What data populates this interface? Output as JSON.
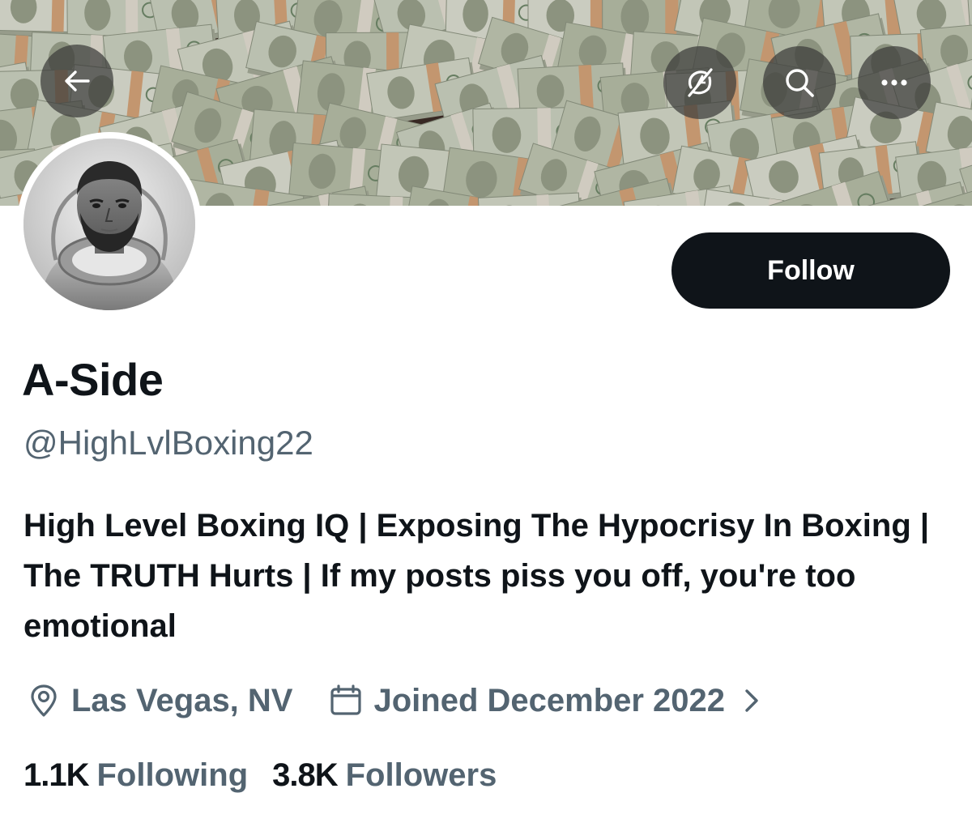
{
  "banner": {
    "description_icon": "money-stacks-banner"
  },
  "toolbar": {
    "back_icon": "arrow-left-icon",
    "notifications_icon": "bell-off-icon",
    "search_icon": "search-icon",
    "more_icon": "more-horizontal-icon"
  },
  "profile": {
    "display_name": "A-Side",
    "handle": "@HighLvlBoxing22",
    "bio": "High Level Boxing IQ | Exposing The Hypocrisy In Boxing | The TRUTH Hurts | If my posts piss you off, you're too emotional",
    "location": "Las Vegas, NV",
    "joined": "Joined December 2022",
    "following_count": "1.1K",
    "following_label": "Following",
    "followers_count": "3.8K",
    "followers_label": "Followers"
  },
  "actions": {
    "follow_label": "Follow"
  },
  "colors": {
    "text_primary": "#0f1419",
    "text_secondary": "#536471",
    "button_bg": "#0f1419",
    "button_text": "#ffffff",
    "overlay_bg": "rgba(60,60,58,0.72)"
  }
}
